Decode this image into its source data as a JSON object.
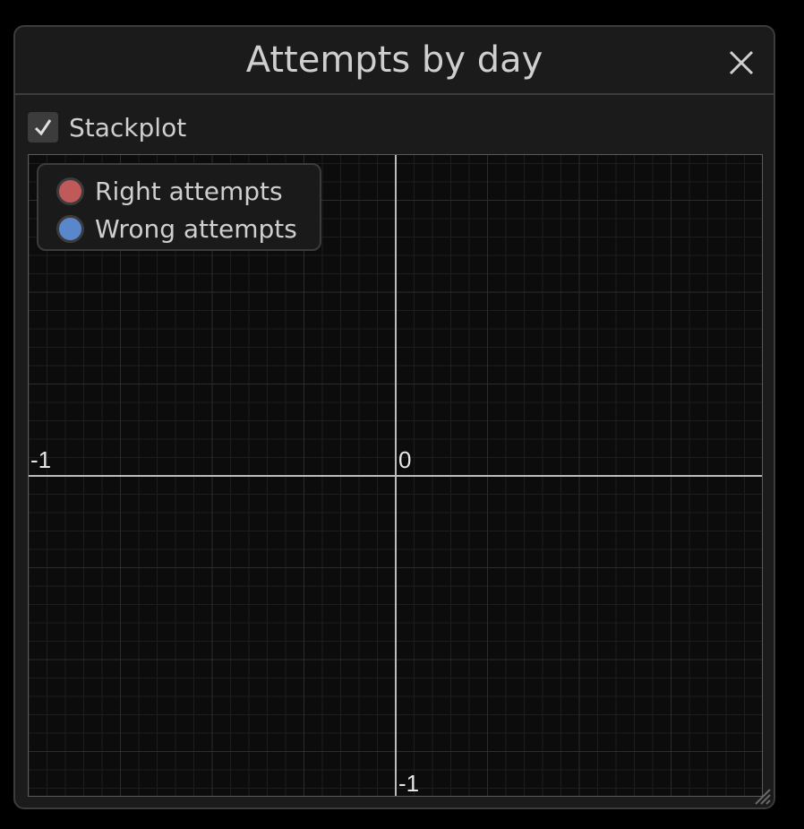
{
  "window": {
    "title": "Attempts by day",
    "close_icon": "close-icon",
    "resize_icon": "resize-handle-icon"
  },
  "controls": {
    "stackplot_label": "Stackplot",
    "stackplot_checked": true
  },
  "legend": [
    {
      "label": "Right attempts",
      "color": "#c05a5a"
    },
    {
      "label": "Wrong attempts",
      "color": "#5a86cc"
    }
  ],
  "axes": {
    "x_tick_left": "-1",
    "origin_tick": "0",
    "y_tick_bottom": "-1"
  },
  "chart_data": {
    "type": "area",
    "series": [
      {
        "name": "Right attempts",
        "values": []
      },
      {
        "name": "Wrong attempts",
        "values": []
      }
    ],
    "xlim": [
      -1,
      1
    ],
    "ylim": [
      -1,
      1
    ],
    "grid": true,
    "legend_position": "top-left"
  }
}
